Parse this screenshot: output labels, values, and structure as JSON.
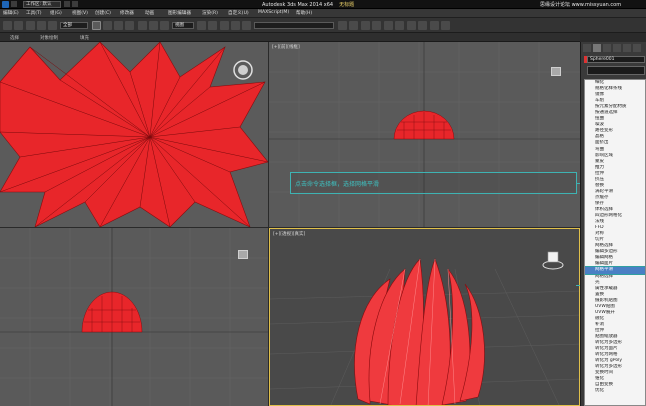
{
  "titlebar": {
    "workspace": "工作区: 默认",
    "title": "Autodesk 3ds Max  2014 x64",
    "doc": "无标题",
    "watermark": "思缘设计论坛  www.missyuan.com"
  },
  "menu": [
    "编辑(E)",
    "工具(T)",
    "组(G)",
    "视图(V)",
    "创建(C)",
    "修改器",
    "动画",
    "图形编辑器",
    "渲染(R)",
    "自定义(U)",
    "MAXScript(M)",
    "帮助(H)"
  ],
  "toolbar": {
    "filter": "全部",
    "refsys": "视图",
    "selset": ""
  },
  "subbar": [
    "选择",
    "对象绘制",
    "填充"
  ],
  "viewports": {
    "top_label": "",
    "front_label": "[+][前][线框]",
    "left_label": "",
    "persp_label": "[+][透视][真实]"
  },
  "panel": {
    "object_name": "Sphere001"
  },
  "callout": {
    "text": "点击命令选择框，选择网格平滑"
  },
  "modifiers": {
    "items": [
      "细化",
      "规格化样条线",
      "镜像",
      "车削",
      "按元素分配材质",
      "按通道选择",
      "扭曲",
      "噪波",
      "路径变形",
      "晶格",
      "面挤出",
      "弯曲",
      "影响区域",
      "蒙皮",
      "推力",
      "拉伸",
      "挤压",
      "替换",
      "涡轮平滑",
      "点缓存",
      "保存",
      "体积选择",
      "四边形网格化",
      "法线",
      "FFD",
      "对称",
      "切片",
      "网格选择",
      "编辑多边形",
      "编辑网格",
      "编辑面片",
      "网格平滑",
      "网格选择",
      "壳",
      "属性承载器",
      "置换",
      "摄影机贴图",
      "UVW贴图",
      "UVW展开",
      "融化",
      "补洞",
      "拉伸",
      "贴图缩放器",
      "转化为多边形",
      "转化为面片",
      "转化为网格",
      "转化为 gPoly",
      "转化为多边形",
      "变换时间",
      "锥化",
      "自由变换",
      "优化"
    ],
    "highlighted_index": 31
  },
  "colors": {
    "mesh": "#e8262a",
    "accent": "#3eb3b3",
    "active_viewport": "#e0c04a"
  }
}
